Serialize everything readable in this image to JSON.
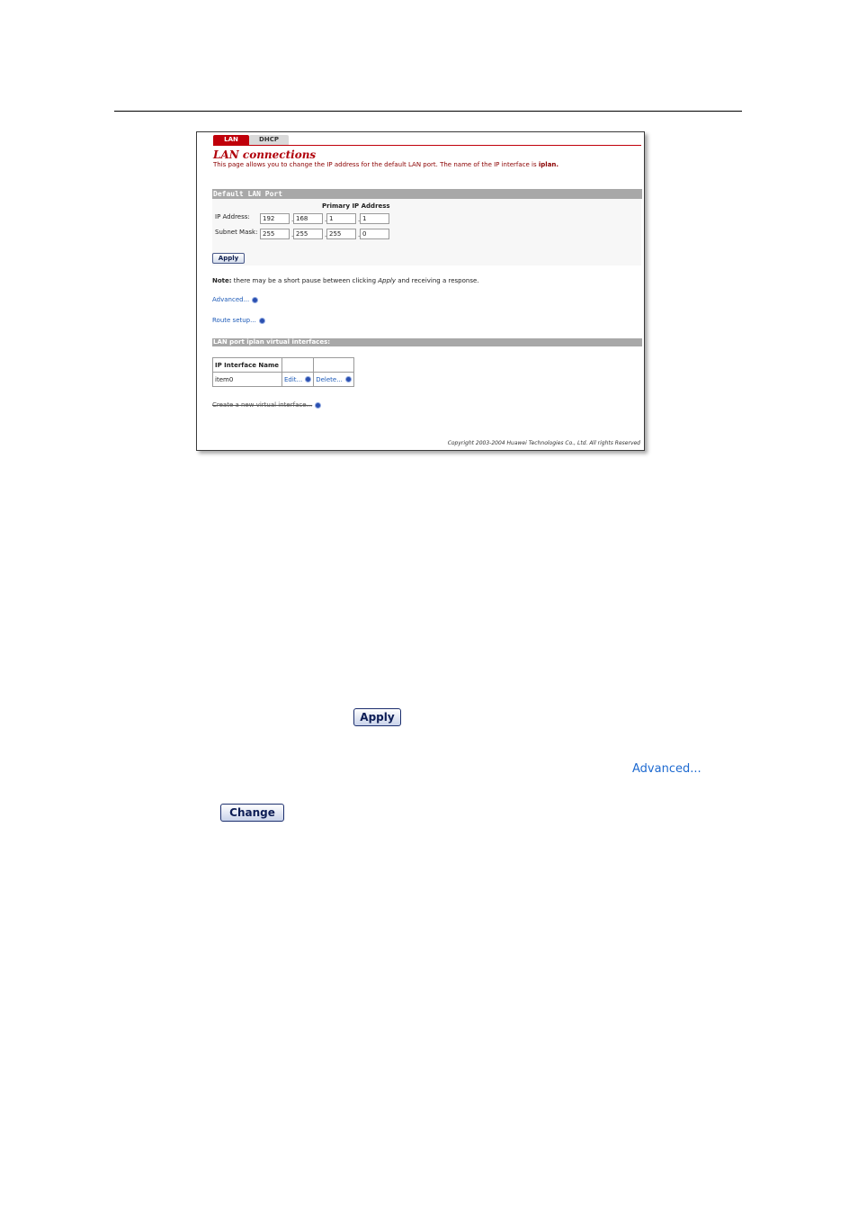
{
  "tabs": [
    {
      "label": "LAN",
      "active": true
    },
    {
      "label": "DHCP",
      "active": false
    }
  ],
  "page": {
    "title": "LAN connections",
    "description_prefix": "This page allows you to change the IP address for the default LAN port. The name of the IP interface is ",
    "description_iface": "iplan.",
    "section_default": "Default LAN Port",
    "primary_ip_heading": "Primary IP Address",
    "ip_label": "IP Address:",
    "mask_label": "Subnet Mask:",
    "ip": [
      "192",
      "168",
      "1",
      "1"
    ],
    "mask": [
      "255",
      "255",
      "255",
      "0"
    ],
    "apply_label": "Apply",
    "note_bold": "Note:",
    "note_text": " there may be a short pause between clicking ",
    "note_italic": "Apply",
    "note_end": " and receiving a response.",
    "advanced_link": "Advanced...",
    "route_link": "Route setup...",
    "section_virtual": "LAN port iplan virtual interfaces:",
    "table": {
      "header": "IP Interface Name",
      "row_name": "item0",
      "edit_label": "Edit...",
      "delete_label": "Delete..."
    },
    "create_link": "Create a new virtual interface...",
    "copyright": "Copyright 2003-2004 Huawei Technologies Co., Ltd. All rights Reserved"
  },
  "doc": {
    "apply_button": "Apply",
    "advanced_link": "Advanced...",
    "change_button": "Change"
  },
  "colors": {
    "accent_red": "#c0000a",
    "link_blue": "#1e5bb8",
    "section_gray": "#a8a8a8"
  }
}
